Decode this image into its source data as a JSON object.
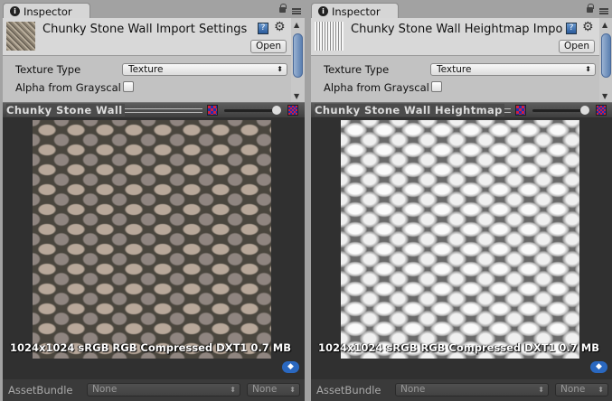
{
  "panels": [
    {
      "tab": "Inspector",
      "title": "Chunky Stone Wall Import Settings",
      "help": "?",
      "open": "Open",
      "texture_type_label": "Texture Type",
      "texture_type_value": "Texture",
      "alpha_label": "Alpha from Grayscal",
      "alpha_checked": false,
      "preview_title": "Chunky Stone Wall",
      "info": "1024x1024 sRGB  RGB Compressed DXT1   0.7 MB",
      "assetbundle_label": "AssetBundle",
      "assetbundle_value": "None",
      "variant_value": "None"
    },
    {
      "tab": "Inspector",
      "title": "Chunky Stone Wall Heightmap Import Settings",
      "help": "?",
      "open": "Open",
      "texture_type_label": "Texture Type",
      "texture_type_value": "Texture",
      "alpha_label": "Alpha from Grayscal",
      "alpha_checked": false,
      "preview_title": "Chunky Stone Wall Heightmap",
      "info": "1024x1024 sRGB  RGB Compressed DXT1   0.7 MB",
      "assetbundle_label": "AssetBundle",
      "assetbundle_value": "None",
      "variant_value": "None"
    }
  ],
  "icons": {
    "info": "info-icon",
    "lock": "lock-icon",
    "menu": "menu-icon",
    "help": "help-book-icon",
    "gear": "gear-icon",
    "tag": "tag-icon"
  }
}
